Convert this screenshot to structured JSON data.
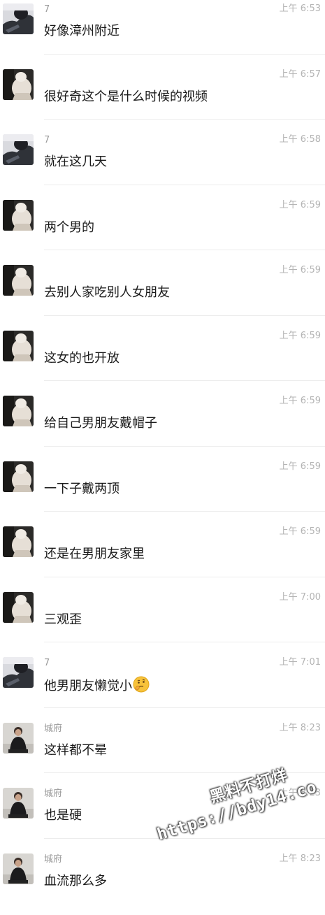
{
  "messages": [
    {
      "avatar": "avatar-a",
      "sender": "7",
      "time": "上午 6:53",
      "text": "好像漳州附近"
    },
    {
      "avatar": "avatar-b",
      "sender": "",
      "time": "上午 6:57",
      "text": "很好奇这个是什么时候的视频"
    },
    {
      "avatar": "avatar-a",
      "sender": "7",
      "time": "上午 6:58",
      "text": "就在这几天"
    },
    {
      "avatar": "avatar-b",
      "sender": "",
      "time": "上午 6:59",
      "text": "两个男的"
    },
    {
      "avatar": "avatar-b",
      "sender": "",
      "time": "上午 6:59",
      "text": "去别人家吃别人女朋友"
    },
    {
      "avatar": "avatar-b",
      "sender": "",
      "time": "上午 6:59",
      "text": "这女的也开放"
    },
    {
      "avatar": "avatar-b",
      "sender": "",
      "time": "上午 6:59",
      "text": "给自己男朋友戴帽子"
    },
    {
      "avatar": "avatar-b",
      "sender": "",
      "time": "上午 6:59",
      "text": "一下子戴两顶"
    },
    {
      "avatar": "avatar-b",
      "sender": "",
      "time": "上午 6:59",
      "text": "还是在男朋友家里"
    },
    {
      "avatar": "avatar-b",
      "sender": "",
      "time": "上午 7:00",
      "text": "三观歪"
    },
    {
      "avatar": "avatar-a",
      "sender": "7",
      "time": "上午 7:01",
      "text": "他男朋友懒觉小",
      "emoji": "thinking-face-emoji"
    },
    {
      "avatar": "avatar-c",
      "sender": "城府",
      "time": "上午 8:23",
      "text": "这样都不晕"
    },
    {
      "avatar": "avatar-c",
      "sender": "城府",
      "time": "上午 8:23",
      "text": "也是硬"
    },
    {
      "avatar": "avatar-c",
      "sender": "城府",
      "time": "上午 8:23",
      "text": "血流那么多"
    }
  ],
  "watermark": {
    "line1": "黑料不打烊",
    "line2": "https://bdy14.co"
  }
}
